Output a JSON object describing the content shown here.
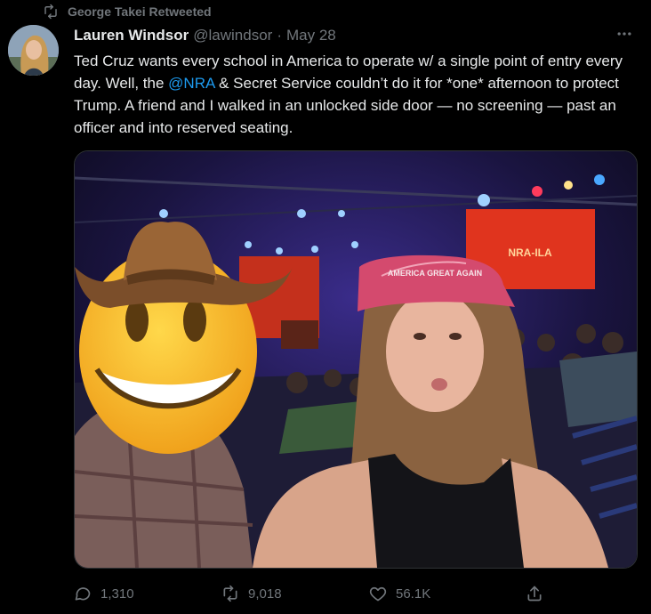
{
  "retweet_banner": {
    "icon": "retweet-icon",
    "text": "George Takei Retweeted"
  },
  "tweet": {
    "author_name": "Lauren Windsor",
    "author_handle": "@lawindsor",
    "separator": "·",
    "date": "May 28",
    "more_icon": "more-icon",
    "text_part1": "Ted Cruz wants every school in America to operate w/ a single point of entry every day. Well, the ",
    "mention": "@NRA",
    "text_part2": " & Secret Service couldn’t do it for *one* afternoon to protect Trump. A friend and I walked in an unlocked side door — no screening — past an officer and into reserved seating.",
    "photo_cap_text": "AMERICA GREAT AGAIN",
    "photo_screen_text": "NRA-ILA"
  },
  "actions": {
    "reply_count": "1,310",
    "retweet_count": "9,018",
    "like_count": "56.1K"
  },
  "colors": {
    "background": "#000000",
    "text": "#e7e9ea",
    "muted": "#71767b",
    "link": "#1d9bf0"
  }
}
